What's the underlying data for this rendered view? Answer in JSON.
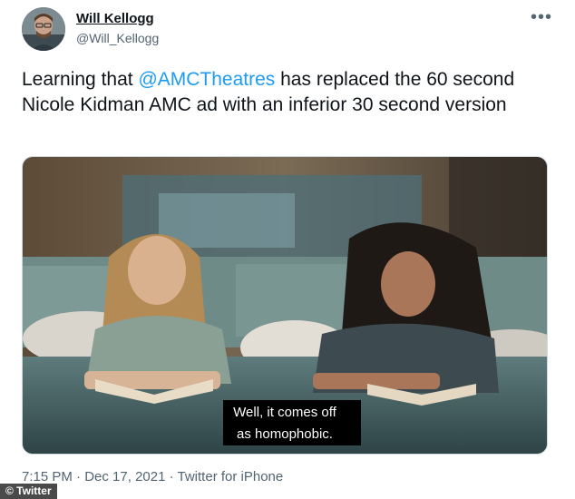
{
  "author": {
    "name": "Will Kellogg",
    "handle": "@Will_Kellogg"
  },
  "more_glyph": "•••",
  "tweet": {
    "text_before": "Learning that ",
    "mention": "@AMCTheatres",
    "text_after": " has replaced the 60 second Nicole Kidman AMC ad with an inferior 30 second version"
  },
  "media": {
    "subtitle_line1": "Well, it comes off",
    "subtitle_line2": "as homophobic."
  },
  "meta": {
    "time": "7:15 PM",
    "date": "Dec 17, 2021",
    "source": "Twitter for iPhone",
    "separator": " · "
  },
  "credit": "© Twitter",
  "colors": {
    "mention": "#1d9bf0",
    "secondary_text": "#536471"
  }
}
